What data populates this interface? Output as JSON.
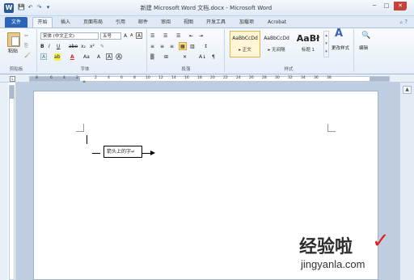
{
  "window": {
    "title": "新建 Microsoft Word 文档.docx - Microsoft Word",
    "logo": "W",
    "quick_access": [
      "💾",
      "↶",
      "↷",
      "▾"
    ],
    "controls": {
      "minimize": "─",
      "maximize": "□",
      "close": "✕"
    }
  },
  "tabs": {
    "file": "文件",
    "items": [
      "开始",
      "插入",
      "页面布局",
      "引用",
      "邮件",
      "审阅",
      "视图",
      "开发工具",
      "加载项",
      "Acrobat"
    ],
    "right_icons": "▵ ?"
  },
  "ribbon": {
    "clipboard": {
      "paste_label": "粘贴",
      "group_label": "剪贴板"
    },
    "font": {
      "font_name": "宋体 (中文正文)",
      "font_size": "五号",
      "row2": [
        "B",
        "I",
        "U",
        "·",
        "abe",
        "x₂",
        "x²",
        "A"
      ],
      "row3": [
        "A",
        "·",
        "ab",
        "·",
        "A",
        "·",
        "Aa",
        "A",
        "A",
        "A"
      ],
      "row1_extra": [
        "A",
        "A",
        "Aa",
        "变",
        "A"
      ],
      "group_label": "字体"
    },
    "paragraph": {
      "row1": [
        "☰",
        "☰",
        "☰",
        "⇤",
        "⇥",
        "A↓",
        "¶"
      ],
      "row2": [
        "≡",
        "≡",
        "≡",
        "▦",
        "▥",
        "↕"
      ],
      "row3": [
        "▒",
        "·",
        "⊞",
        "·",
        "✕",
        "A↓",
        "¶"
      ],
      "group_label": "段落"
    },
    "styles": {
      "tiles": [
        {
          "preview": "AaBbCcDd",
          "name": "▸ 正文"
        },
        {
          "preview": "AaBbCcDd",
          "name": "▸ 无间隔"
        },
        {
          "preview": "AaBł",
          "name": "标题 1"
        }
      ],
      "change_styles": "更改样式",
      "group_label": "样式"
    },
    "editing": {
      "label": "编辑"
    }
  },
  "ruler": {
    "numbers": [
      "8",
      "6",
      "4",
      "2",
      "2",
      "4",
      "6",
      "8",
      "10",
      "12",
      "14",
      "16",
      "18",
      "20",
      "22",
      "24",
      "26",
      "28",
      "30",
      "32",
      "34",
      "36",
      "38"
    ]
  },
  "document": {
    "textbox_text": "箭头上的字↵"
  },
  "watermark": {
    "site_cn": "经验啦",
    "check": "✓",
    "site_url": "jingyanla.com"
  }
}
